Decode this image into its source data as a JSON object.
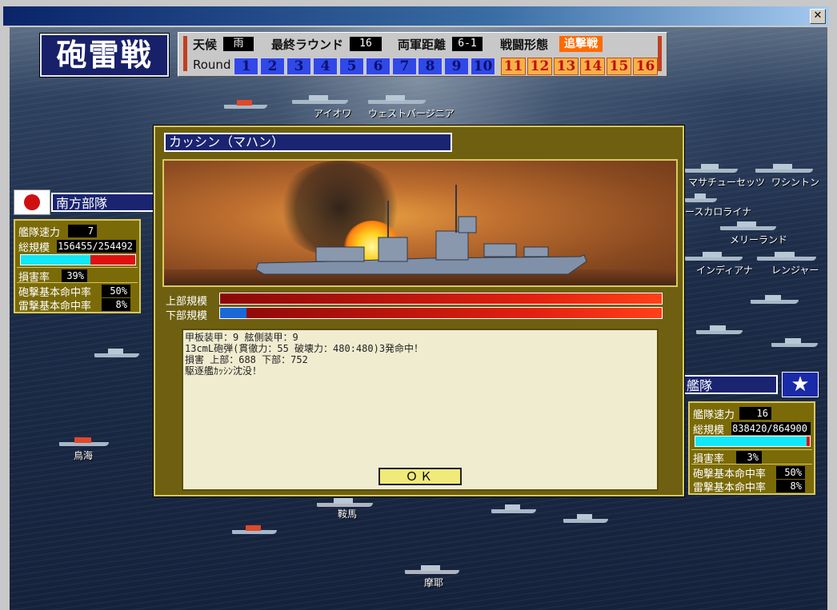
{
  "window": {
    "close_label": "✕"
  },
  "header": {
    "game_title": "砲雷戦",
    "weather_label": "天候",
    "weather_value": "雨",
    "final_round_label": "最終ラウンド",
    "final_round_value": "16",
    "distance_label": "両軍距離",
    "distance_value": "6-1",
    "battle_form_label": "戦闘形態",
    "battle_form_value": "追撃戦",
    "round_label": "Round",
    "rounds_group1": [
      "1",
      "2",
      "3",
      "4",
      "5",
      "6",
      "7"
    ],
    "rounds_group2": [
      "8",
      "9",
      "10"
    ],
    "rounds_group3": [
      "11",
      "12",
      "13",
      "14",
      "15",
      "16"
    ]
  },
  "ships": {
    "iowa": "アイオワ",
    "west_virginia": "ウェストバージニア",
    "massachusetts": "マサチューセッツ",
    "washington": "ワシントン",
    "south_carolina": "ースカロライナ",
    "maryland": "メリーランド",
    "indiana": "インディアナ",
    "ranger": "レンジャー",
    "chokai": "鳥海",
    "kurama": "鞍馬",
    "maya": "摩耶"
  },
  "left_fleet": {
    "name": "南方部隊",
    "speed_label": "艦隊速力",
    "speed_value": "7",
    "scale_label": "総規模",
    "scale_value": "156455/254492",
    "scale_ratio": 0.61,
    "damage_label": "損害率",
    "damage_value": "39%",
    "gun_hit_label": "砲撃基本命中率",
    "gun_hit_value": "50%",
    "torp_hit_label": "雷撃基本命中率",
    "torp_hit_value": "8%"
  },
  "right_fleet": {
    "name": "艦隊",
    "speed_label": "艦隊速力",
    "speed_value": "16",
    "scale_label": "総規模",
    "scale_value": "838420/864900",
    "scale_ratio": 0.97,
    "damage_label": "損害率",
    "damage_value": "3%",
    "gun_hit_label": "砲撃基本命中率",
    "gun_hit_value": "50%",
    "torp_hit_label": "雷撃基本命中率",
    "torp_hit_value": "8%"
  },
  "dialog": {
    "title": "カッシン（マハン）",
    "upper_label": "上部規模",
    "lower_label": "下部規模",
    "upper_ratio": 0.0,
    "lower_ratio": 0.06,
    "message": "甲板装甲：9 舷側装甲：9\n13cmL砲弾(貫徹力：55 破壊力：480:480)3発命中！\n損害 上部：688 下部：752\n駆逐艦ｶｯｼﾝ沈没！",
    "ok_label": "ＯＫ"
  },
  "colors": {
    "rounds_done": "#3048e8",
    "rounds_remaining": "#f8b048",
    "panel": "#7a6a08",
    "title_bg": "#1a2470"
  }
}
